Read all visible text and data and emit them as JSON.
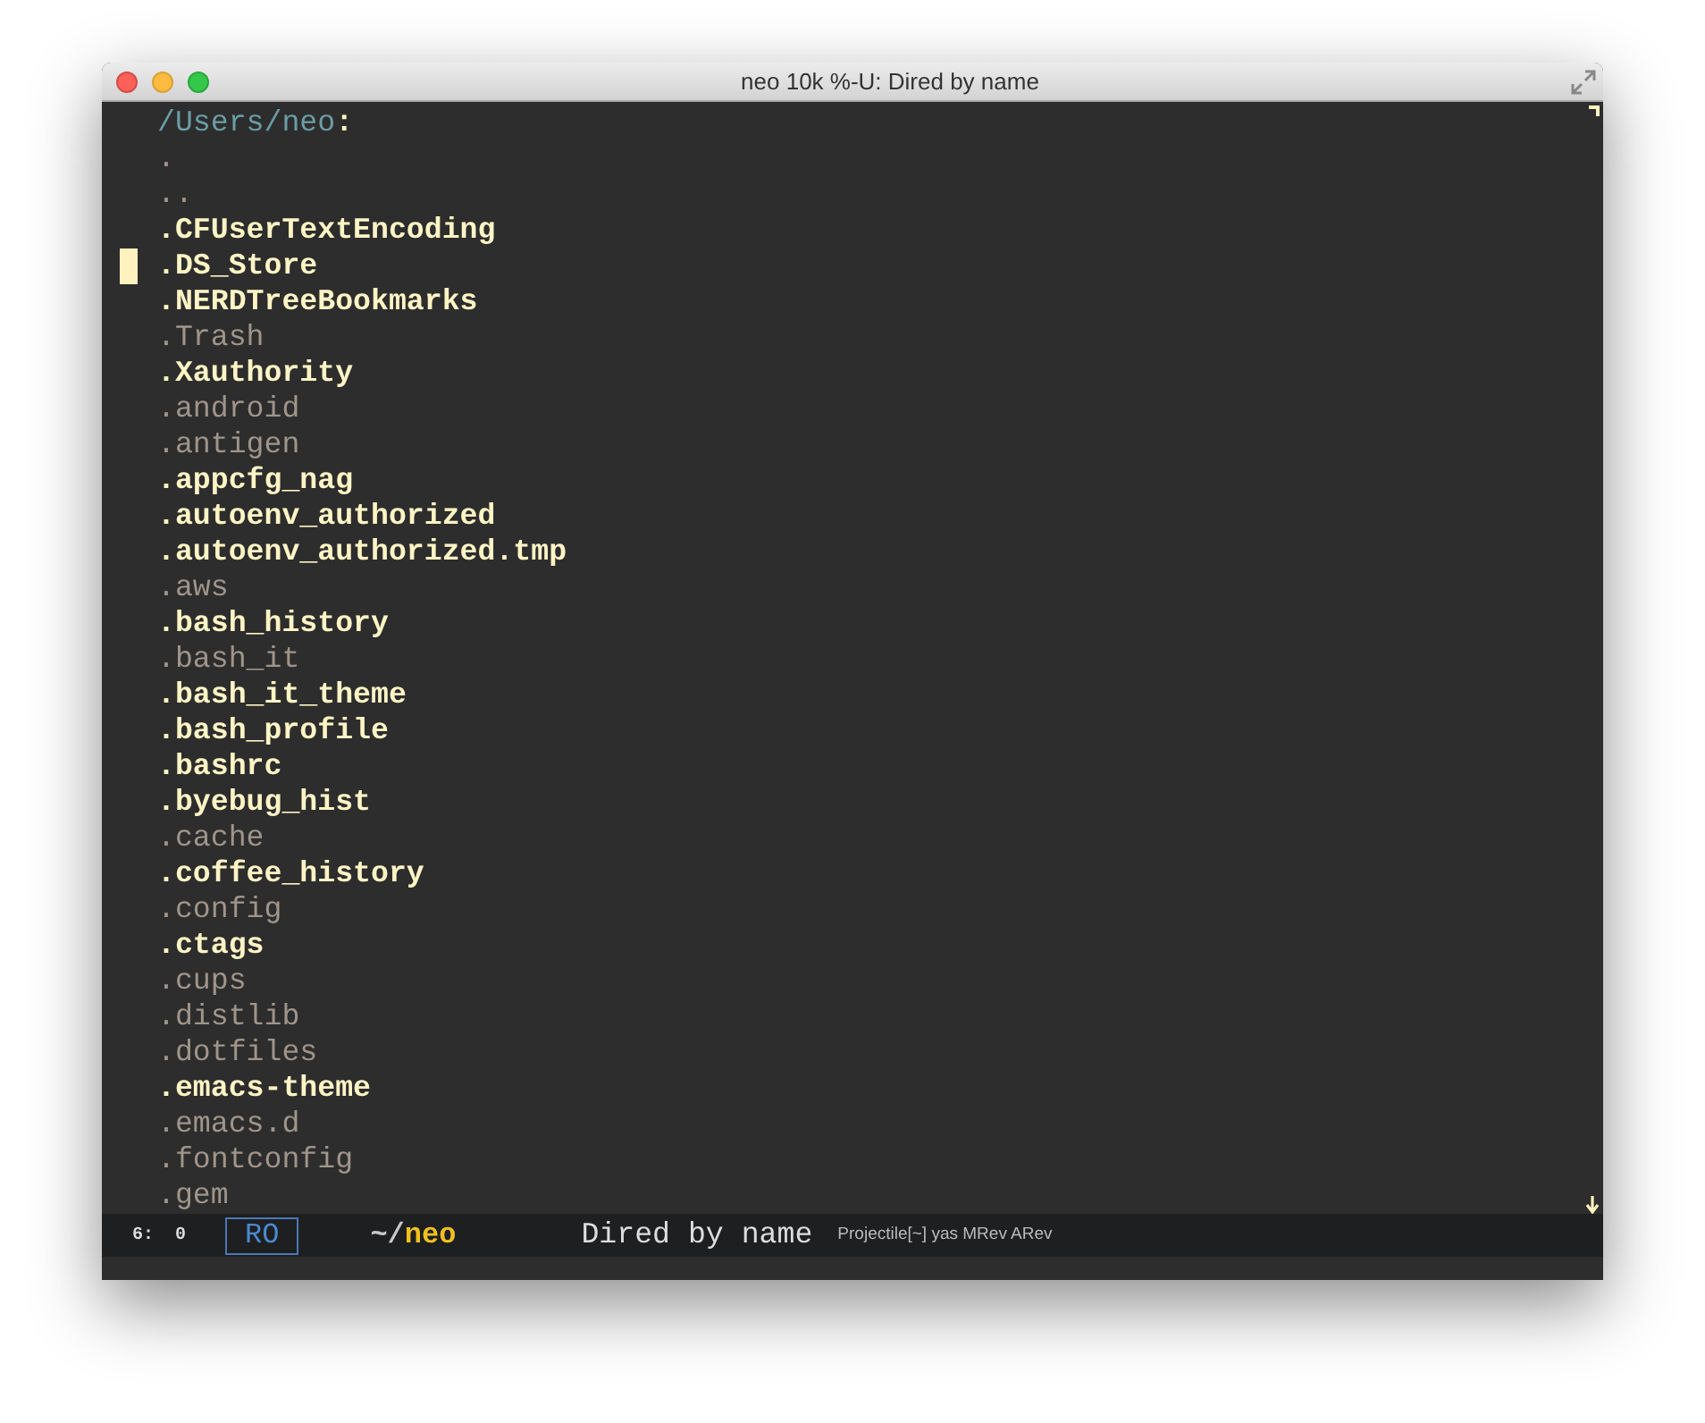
{
  "window": {
    "title": "neo 10k %-U: Dired by name"
  },
  "buffer": {
    "path": "/Users/neo",
    "path_suffix": ":",
    "entries": [
      {
        "name": ".",
        "kind": "dir",
        "selected": false
      },
      {
        "name": "..",
        "kind": "dir",
        "selected": false
      },
      {
        "name": ".CFUserTextEncoding",
        "kind": "file",
        "selected": false
      },
      {
        "name": ".DS_Store",
        "kind": "file",
        "selected": true
      },
      {
        "name": ".NERDTreeBookmarks",
        "kind": "file",
        "selected": false
      },
      {
        "name": ".Trash",
        "kind": "dir",
        "selected": false
      },
      {
        "name": ".Xauthority",
        "kind": "file",
        "selected": false
      },
      {
        "name": ".android",
        "kind": "dir",
        "selected": false
      },
      {
        "name": ".antigen",
        "kind": "dir",
        "selected": false
      },
      {
        "name": ".appcfg_nag",
        "kind": "file",
        "selected": false
      },
      {
        "name": ".autoenv_authorized",
        "kind": "file",
        "selected": false
      },
      {
        "name": ".autoenv_authorized.tmp",
        "kind": "file",
        "selected": false
      },
      {
        "name": ".aws",
        "kind": "dir",
        "selected": false
      },
      {
        "name": ".bash_history",
        "kind": "file",
        "selected": false
      },
      {
        "name": ".bash_it",
        "kind": "dir",
        "selected": false
      },
      {
        "name": ".bash_it_theme",
        "kind": "file",
        "selected": false
      },
      {
        "name": ".bash_profile",
        "kind": "file",
        "selected": false
      },
      {
        "name": ".bashrc",
        "kind": "file",
        "selected": false
      },
      {
        "name": ".byebug_hist",
        "kind": "file",
        "selected": false
      },
      {
        "name": ".cache",
        "kind": "dir",
        "selected": false
      },
      {
        "name": ".coffee_history",
        "kind": "file",
        "selected": false
      },
      {
        "name": ".config",
        "kind": "dir",
        "selected": false
      },
      {
        "name": ".ctags",
        "kind": "file",
        "selected": false
      },
      {
        "name": ".cups",
        "kind": "dir",
        "selected": false
      },
      {
        "name": ".distlib",
        "kind": "dir",
        "selected": false
      },
      {
        "name": ".dotfiles",
        "kind": "dir",
        "selected": false
      },
      {
        "name": ".emacs-theme",
        "kind": "file",
        "selected": false
      },
      {
        "name": ".emacs.d",
        "kind": "dir",
        "selected": false
      },
      {
        "name": ".fontconfig",
        "kind": "dir",
        "selected": false
      },
      {
        "name": ".gem",
        "kind": "dir",
        "selected": false
      }
    ]
  },
  "status_bar": {
    "position": "6:  0",
    "read_only": "RO",
    "dir_prefix": "~/",
    "dir_name": "neo",
    "mode": "Dired by name",
    "minor_modes": "Projectile[~] yas MRev ARev"
  }
}
